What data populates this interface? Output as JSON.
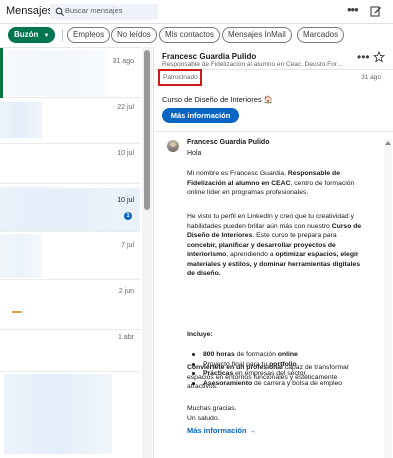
{
  "header": {
    "title": "Mensajes",
    "search_placeholder": "Buscar mensajes"
  },
  "filters": {
    "primary": "Buzón",
    "chips": [
      "Empleos",
      "No leídos",
      "Mis contactos",
      "Mensajes InMail",
      "Marcados"
    ]
  },
  "conversations": [
    {
      "date": "31 ago"
    },
    {
      "date": "22 jul"
    },
    {
      "date": "10 jul"
    },
    {
      "date": "10 jul",
      "unread": "1"
    },
    {
      "date": "7 jul"
    },
    {
      "date": "2 jun"
    },
    {
      "date": "1 abr"
    }
  ],
  "thread": {
    "sender": "Francesc Guardia Pulido",
    "subtitle": "Responsable de Fidelización al alumno en Ceac. Deusto Formación ...",
    "sponsored": "Patrocinado",
    "date": "31 ago",
    "course": "Curso de Diseño de Interiores 🏠",
    "cta": "Más información",
    "message": {
      "author": "Francesc Guardia Pulido",
      "greeting": "Hola",
      "p1_a": "Mi nombre es Francesc Guardia, ",
      "p1_b": "Responsable de Fidelización al alumno en CEAC",
      "p1_c": ", centro de formación online líder en programas profesionales.",
      "p2_a": "He visto tu perfil en LinkedIn y creo que tu creatividad y habilidades pueden brillar aún más con nuestro ",
      "p2_b": "Curso de Diseño de Interiores",
      "p2_c": ". Este curso te prepara para ",
      "p2_d": "concebir, planificar y desarrollar proyectos de interiorismo",
      "p2_e": ", aprendiendo a ",
      "p2_f": "optimizar espacios, elegir materiales y estilos, y dominar herramientas digitales de diseño.",
      "includes": "Incluye:",
      "bullets": [
        {
          "bold": "800 horas",
          "mid": " de formación ",
          "bold2": "online"
        },
        {
          "bold": "",
          "mid": "Proyecto final para tu ",
          "bold2": "portfolio"
        },
        {
          "bold": "Prácticas",
          "mid": " en empresas del sector",
          "bold2": ""
        },
        {
          "bold": "Asesoramiento",
          "mid": " de carrera y bolsa de empleo",
          "bold2": ""
        }
      ],
      "p3_a": "Conviértete en un profesional",
      "p3_b": " capaz de transformar espacios en entornos funcionales y estéticamente atractivos.",
      "signoff1": "Muchas gracias,",
      "signoff2": "Un saludo.",
      "link": "Más información →"
    }
  },
  "colors": {
    "accent": "#0a66c2",
    "primary_chip": "#01754f",
    "sponsored_box": "#d11a1a"
  }
}
